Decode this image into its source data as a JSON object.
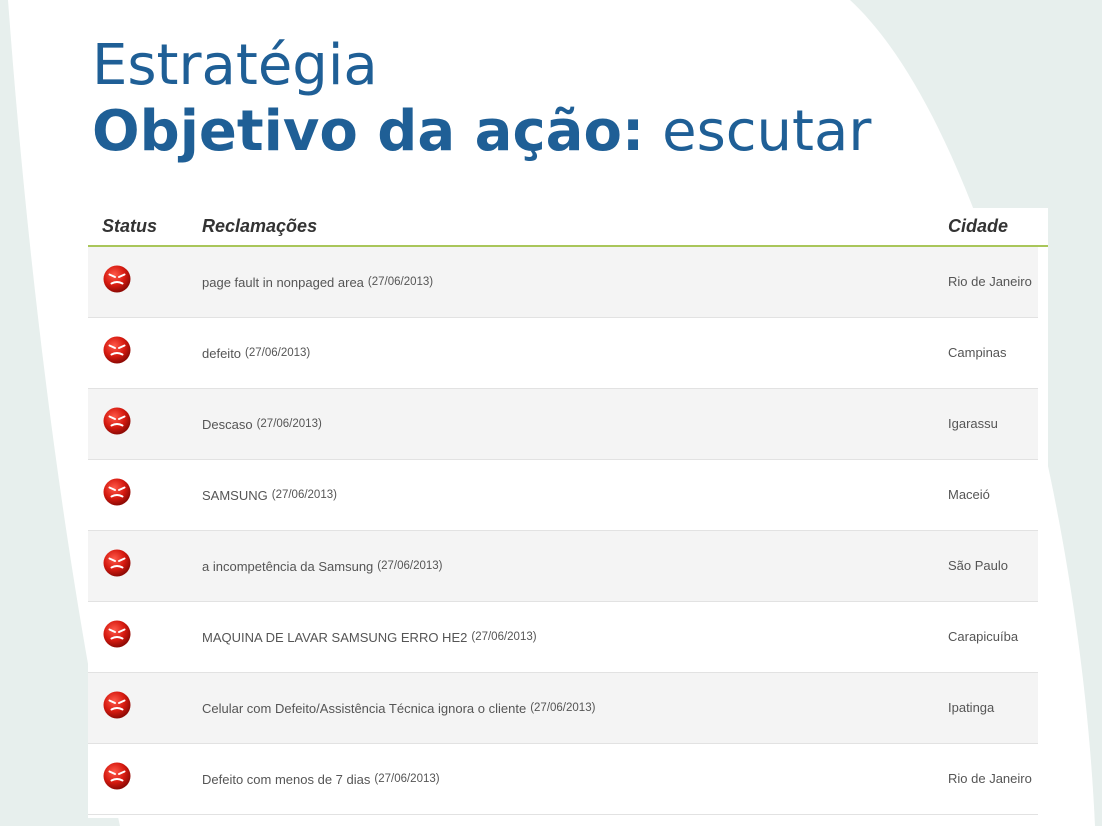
{
  "slide": {
    "title_line1": "Estratégia",
    "title_bold": "Objetivo da ação:",
    "title_normal": "escutar",
    "title_color": "#1f5f96"
  },
  "table": {
    "headers": {
      "status": "Status",
      "complaints": "Reclamações",
      "city": "Cidade"
    },
    "header_underline_color": "#a9c65a",
    "status_icon": "angry-red-face-icon",
    "rows": [
      {
        "complaint": "page fault in nonpaged area",
        "date": "(27/06/2013)",
        "city": "Rio de Janeiro"
      },
      {
        "complaint": "defeito",
        "date": "(27/06/2013)",
        "city": "Campinas"
      },
      {
        "complaint": "Descaso",
        "date": "(27/06/2013)",
        "city": "Igarassu"
      },
      {
        "complaint": "SAMSUNG",
        "date": "(27/06/2013)",
        "city": "Maceió"
      },
      {
        "complaint": "a incompetência da Samsung",
        "date": "(27/06/2013)",
        "city": "São Paulo"
      },
      {
        "complaint": "MAQUINA DE LAVAR SAMSUNG ERRO HE2",
        "date": "(27/06/2013)",
        "city": "Carapicuíba"
      },
      {
        "complaint": "Celular com Defeito/Assistência Técnica ignora o cliente",
        "date": "(27/06/2013)",
        "city": "Ipatinga"
      },
      {
        "complaint": "Defeito com menos de 7 dias",
        "date": "(27/06/2013)",
        "city": "Rio de Janeiro"
      }
    ]
  }
}
